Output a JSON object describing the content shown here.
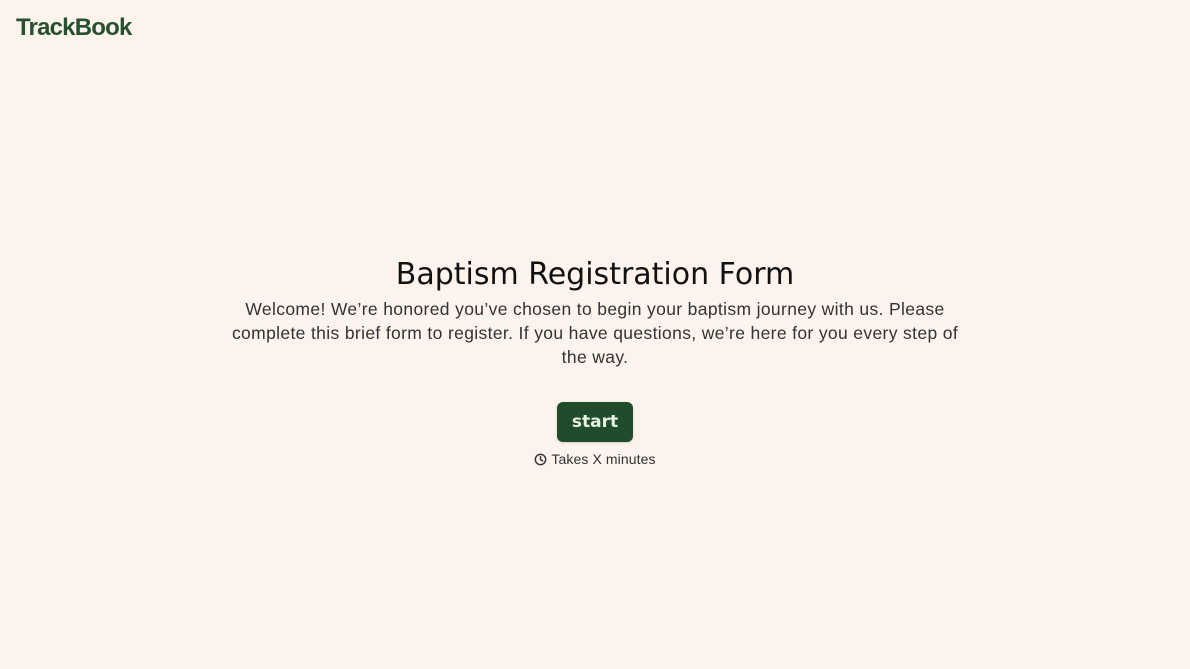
{
  "header": {
    "logo_text": "TrackBook"
  },
  "main": {
    "title": "Baptism Registration Form",
    "description": "Welcome! We’re honored you’ve chosen to begin your baptism journey with us. Please complete this brief form to register. If you have questions, we’re here for you every step of the way.",
    "start_label": "start",
    "duration_text": "Takes X minutes",
    "duration_icon": "clock-icon"
  },
  "colors": {
    "background": "#fbf3ec",
    "brand": "#27502f",
    "button_bg": "#214c2b",
    "button_text": "#e8f3e4"
  }
}
